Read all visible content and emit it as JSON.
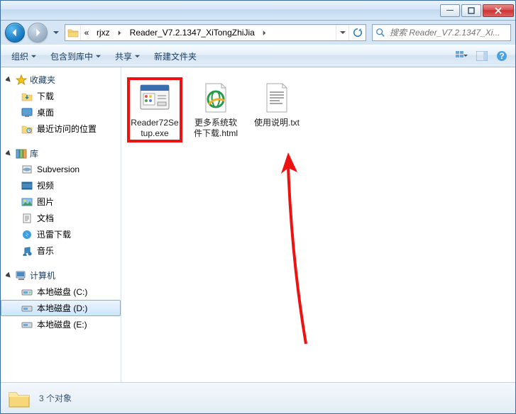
{
  "breadcrumbs": {
    "overflow": "«",
    "part1": "rjxz",
    "part2": "Reader_V7.2.1347_XiTongZhiJia"
  },
  "search": {
    "placeholder": "搜索 Reader_V7.2.1347_Xi..."
  },
  "toolbar": {
    "organize": "组织",
    "include": "包含到库中",
    "share": "共享",
    "newfolder": "新建文件夹"
  },
  "sidebar": {
    "favorites": {
      "label": "收藏夹",
      "items": [
        "下载",
        "桌面",
        "最近访问的位置"
      ]
    },
    "libraries": {
      "label": "库",
      "items": [
        "Subversion",
        "视频",
        "图片",
        "文档",
        "迅雷下载",
        "音乐"
      ]
    },
    "computer": {
      "label": "计算机",
      "items": [
        "本地磁盘 (C:)",
        "本地磁盘 (D:)",
        "本地磁盘 (E:)"
      ]
    }
  },
  "files": [
    {
      "name": "Reader72Setup.exe",
      "highlighted": true,
      "icon": "installer"
    },
    {
      "name": "更多系统软件下载.html",
      "highlighted": false,
      "icon": "html"
    },
    {
      "name": "使用说明.txt",
      "highlighted": false,
      "icon": "txt"
    }
  ],
  "status": {
    "count": "3 个对象"
  }
}
